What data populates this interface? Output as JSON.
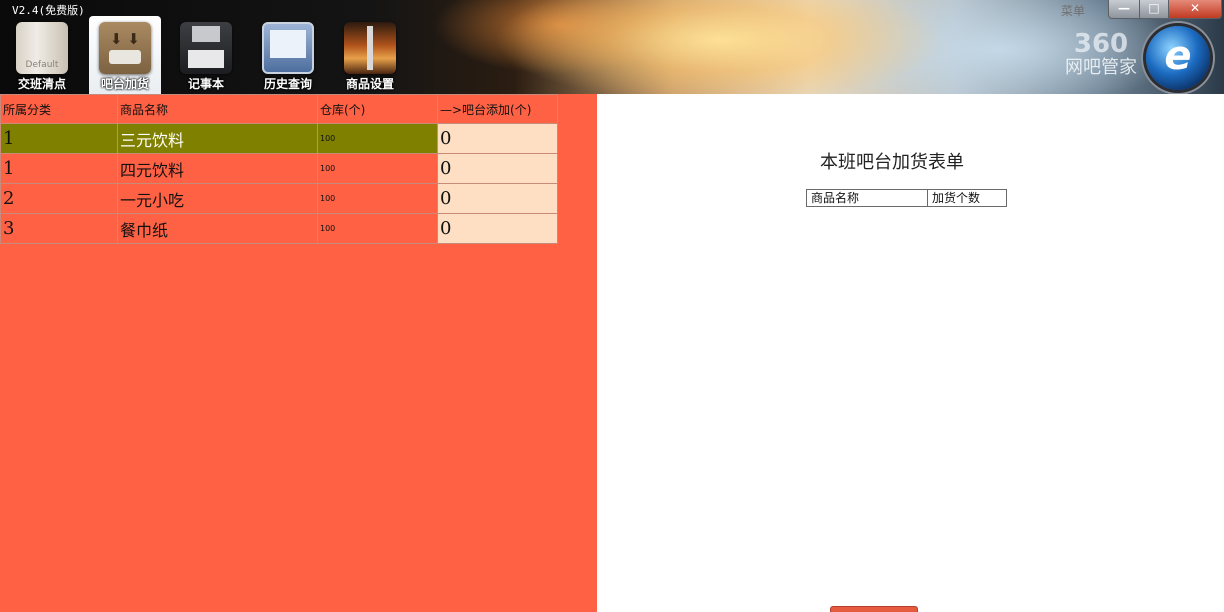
{
  "app": {
    "version": "V2.4(免费版)",
    "menu_label": "菜单"
  },
  "toolbar": [
    {
      "label": "交班清点",
      "icon": "default-wood-icon"
    },
    {
      "label": "吧台加货",
      "icon": "box-download-icon"
    },
    {
      "label": "记事本",
      "icon": "floppy-disk-icon"
    },
    {
      "label": "历史查询",
      "icon": "monitor-icon"
    },
    {
      "label": "商品设置",
      "icon": "guitar-icon"
    }
  ],
  "window_controls": {
    "minimize": "—",
    "maximize": "□",
    "close": "✕"
  },
  "brand": {
    "number": "360",
    "name": "网吧管家",
    "logo_letter": "e"
  },
  "goods_table": {
    "headers": {
      "category": "所属分类",
      "name": "商品名称",
      "stock": "仓库(个)",
      "add": "—>吧台添加(个)"
    },
    "rows": [
      {
        "category": "1",
        "name": "三元饮料",
        "stock": "100",
        "add": "0"
      },
      {
        "category": "1",
        "name": "四元饮料",
        "stock": "100",
        "add": "0"
      },
      {
        "category": "2",
        "name": "一元小吃",
        "stock": "100",
        "add": "0"
      },
      {
        "category": "3",
        "name": "餐巾纸",
        "stock": "100",
        "add": "0"
      }
    ]
  },
  "order_form": {
    "title": "本班吧台加货表单",
    "col_name": "商品名称",
    "col_count": "加货个数"
  },
  "colors": {
    "left_panel_bg": "#ff6144",
    "selected_row": "#808000",
    "input_cell": "#ffdfc3"
  }
}
